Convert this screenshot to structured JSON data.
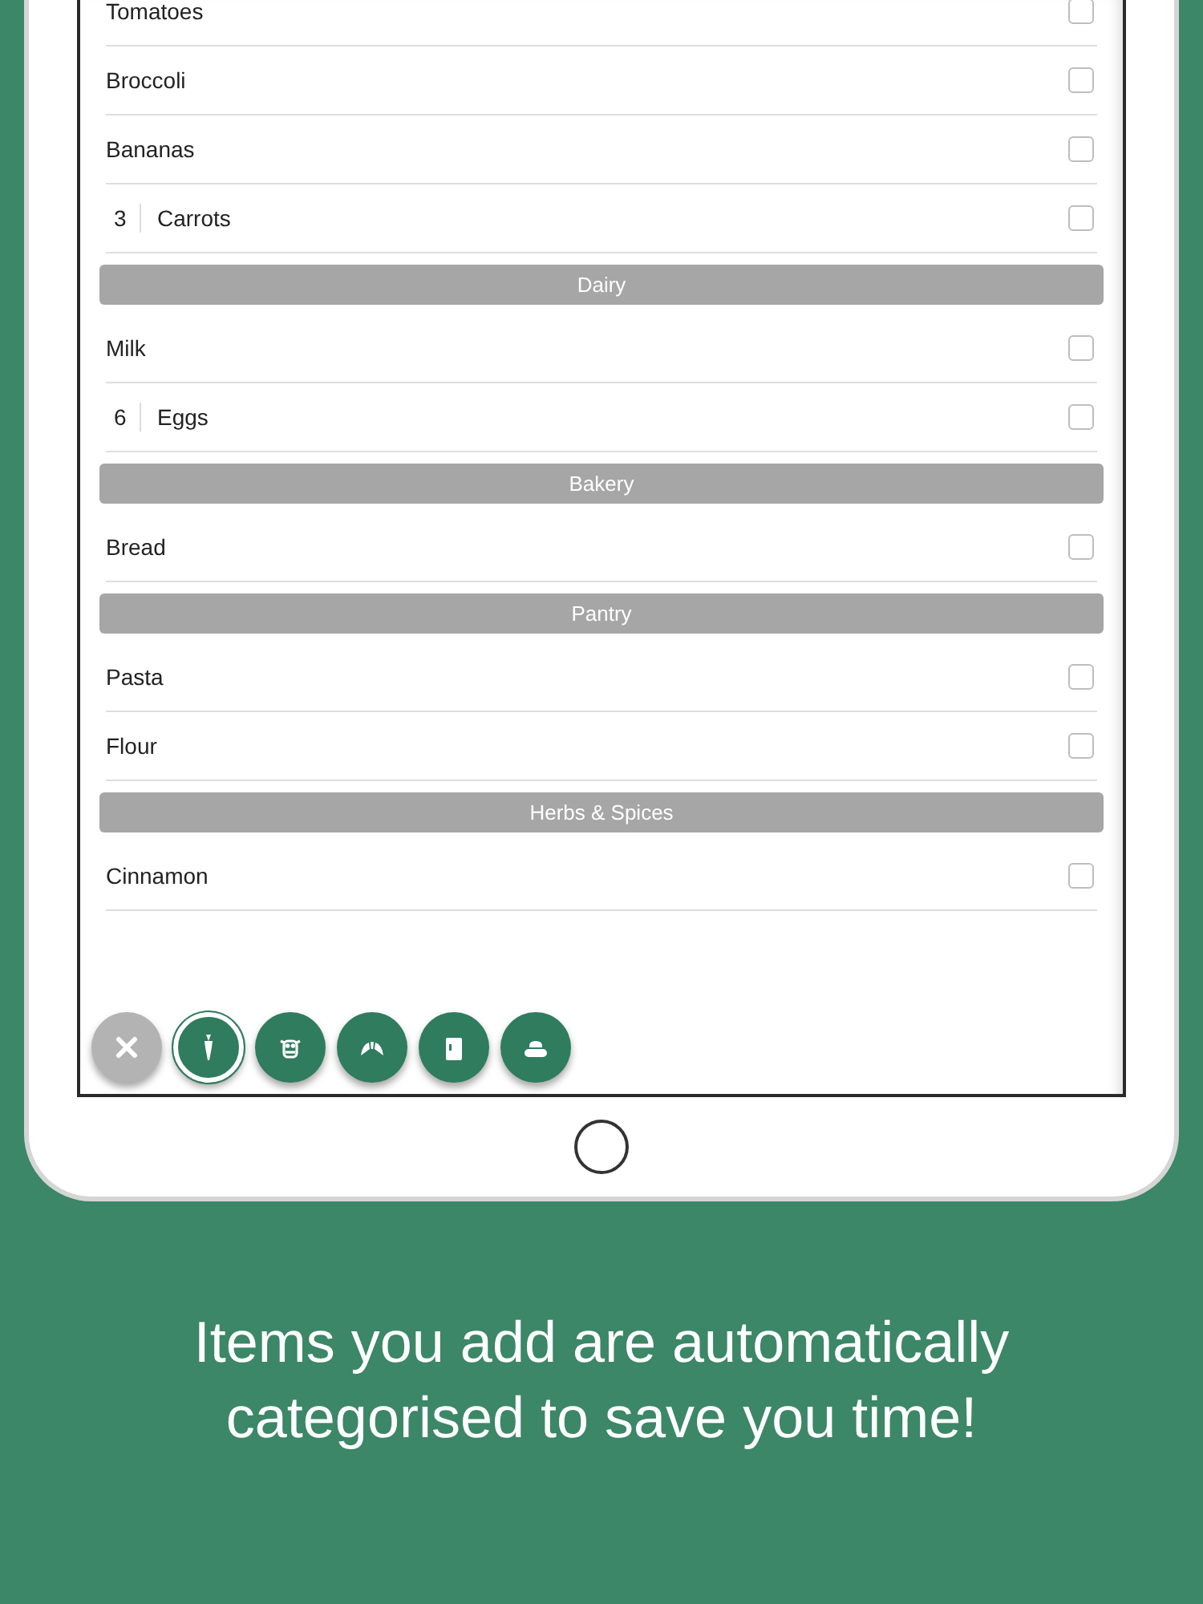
{
  "sections": [
    {
      "items": [
        {
          "name": "Tomatoes",
          "checked": false
        },
        {
          "name": "Broccoli",
          "checked": false
        },
        {
          "name": "Bananas",
          "checked": false
        },
        {
          "quantity": "3",
          "name": "Carrots",
          "checked": false
        }
      ]
    },
    {
      "header": "Dairy",
      "items": [
        {
          "name": "Milk",
          "checked": false
        },
        {
          "quantity": "6",
          "name": "Eggs",
          "checked": false
        }
      ]
    },
    {
      "header": "Bakery",
      "items": [
        {
          "name": "Bread",
          "checked": false
        }
      ]
    },
    {
      "header": "Pantry",
      "items": [
        {
          "name": "Pasta",
          "checked": false
        },
        {
          "name": "Flour",
          "checked": false
        }
      ]
    },
    {
      "header": "Herbs & Spices",
      "items": [
        {
          "name": "Cinnamon",
          "checked": false
        }
      ]
    }
  ],
  "filters": [
    {
      "kind": "clear"
    },
    {
      "kind": "category",
      "selected": true
    },
    {
      "kind": "category",
      "selected": false
    },
    {
      "kind": "category",
      "selected": false
    },
    {
      "kind": "category",
      "selected": false
    },
    {
      "kind": "category",
      "selected": false
    }
  ],
  "caption": "Items you add are automatically categorised to save you time!"
}
